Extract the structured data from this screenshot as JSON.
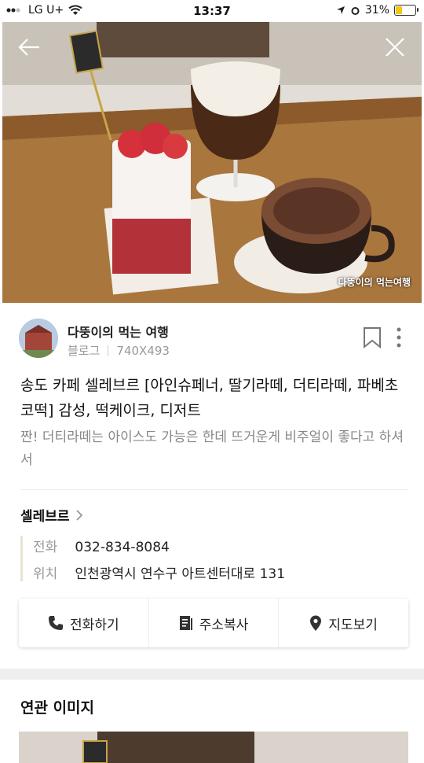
{
  "status": {
    "carrier": "LG U+",
    "time": "13:37",
    "battery": "31%",
    "battery_level": 0.31
  },
  "photo": {
    "watermark": "다뚱이의 먹는여행"
  },
  "blog": {
    "name": "다뚱이의 먹는 여행",
    "type": "블로그",
    "size": "740X493"
  },
  "post": {
    "title": "송도 카페 셀레브르 [아인슈페너, 딸기라떼, 더티라떼, 파베초코떡] 감성, 떡케이크, 디저트",
    "snippet": "짠! 더티라떼는 아이스도 가능은 한데 뜨거운게 비주얼이 좋다고 하셔서"
  },
  "place": {
    "name": "셀레브르",
    "phone_label": "전화",
    "phone": "032-834-8084",
    "location_label": "위치",
    "address": "인천광역시 연수구 아트센터대로 131"
  },
  "actions": {
    "call": "전화하기",
    "copy": "주소복사",
    "map": "지도보기"
  },
  "related": {
    "title": "연관 이미지"
  }
}
